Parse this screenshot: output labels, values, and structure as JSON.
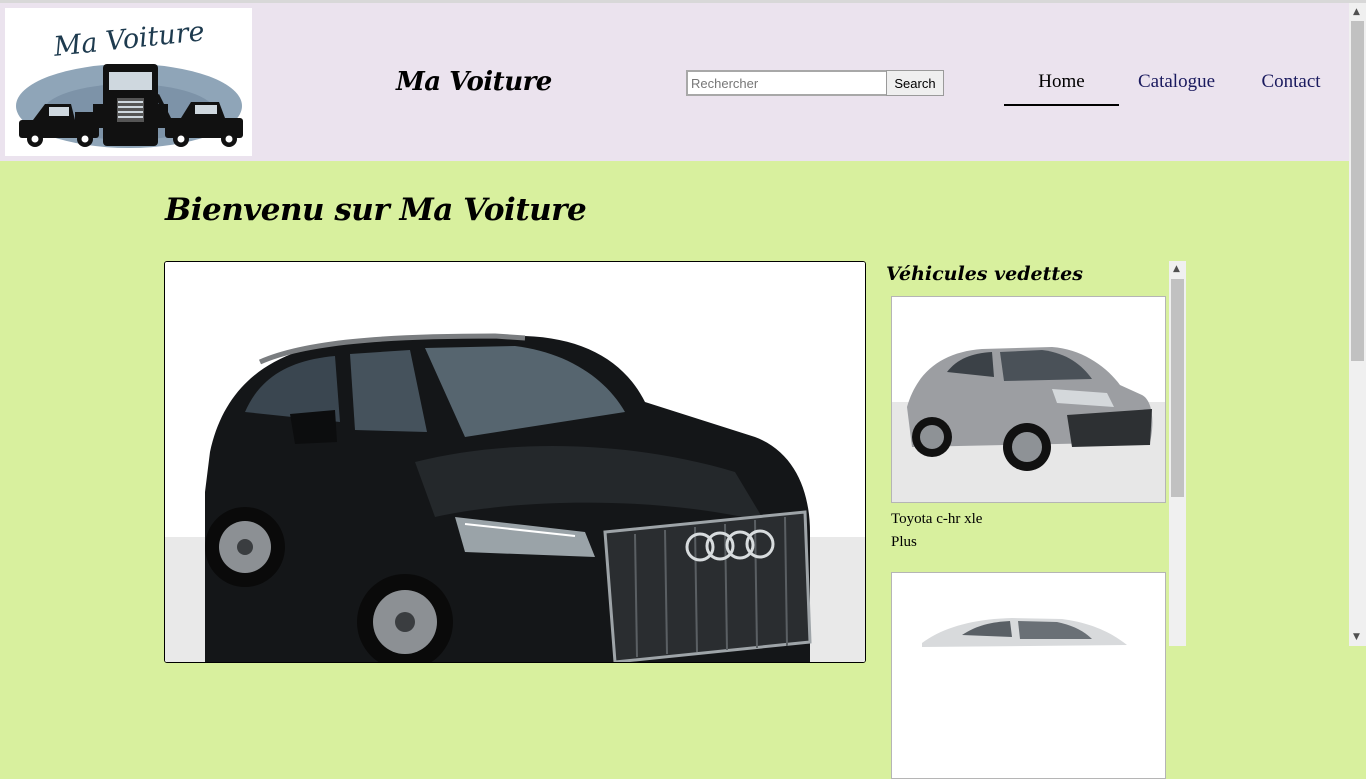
{
  "header": {
    "logo_text": "Ma Voiture",
    "site_title": "Ma Voiture",
    "search": {
      "placeholder": "Rechercher",
      "value": "",
      "button_label": "Search"
    },
    "nav": [
      {
        "label": "Home",
        "active": true
      },
      {
        "label": "Catalogue",
        "active": false
      },
      {
        "label": "Contact",
        "active": false
      }
    ]
  },
  "main": {
    "heading": "Bienvenu sur Ma Voiture",
    "hero_image": "black-audi-suv-photo"
  },
  "sidebar": {
    "title": "Véhicules vedettes",
    "cards": [
      {
        "image": "grey-toyota-chr-photo",
        "name": "Toyota c-hr xle",
        "more_label": "Plus"
      },
      {
        "image": "white-sedan-photo"
      }
    ]
  },
  "colors": {
    "page_background": "#d8f09e",
    "header_background": "#ebe3ee",
    "nav_link": "#1a1a5e"
  }
}
